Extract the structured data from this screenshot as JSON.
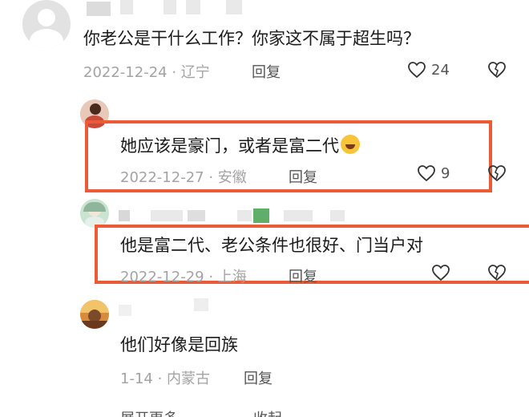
{
  "comments": [
    {
      "text": "你老公是干什么工作？你家这不属于超生吗？",
      "meta": "2022-12-24 · 辽宁",
      "reply": "回复",
      "likes": "24"
    },
    {
      "text": "她应该是豪门，或者是富二代",
      "meta": "2022-12-27 · 安徽",
      "reply": "回复",
      "likes": "9"
    },
    {
      "text": "他是富二代、老公条件也很好、门当户对",
      "meta": "2022-12-29 · 上海",
      "reply": "回复",
      "likes": ""
    },
    {
      "text": "他们好像是回族",
      "meta": "1-14 · 内蒙古",
      "reply": "回复"
    }
  ],
  "footer": {
    "expand_label": "展开更多",
    "collapse_label": "收起"
  },
  "colors": {
    "highlight": "#ea5b36",
    "meta": "#a3a3a3"
  },
  "icons": [
    "heart-outline-icon",
    "broken-heart-icon",
    "laughing-emoji-icon"
  ]
}
